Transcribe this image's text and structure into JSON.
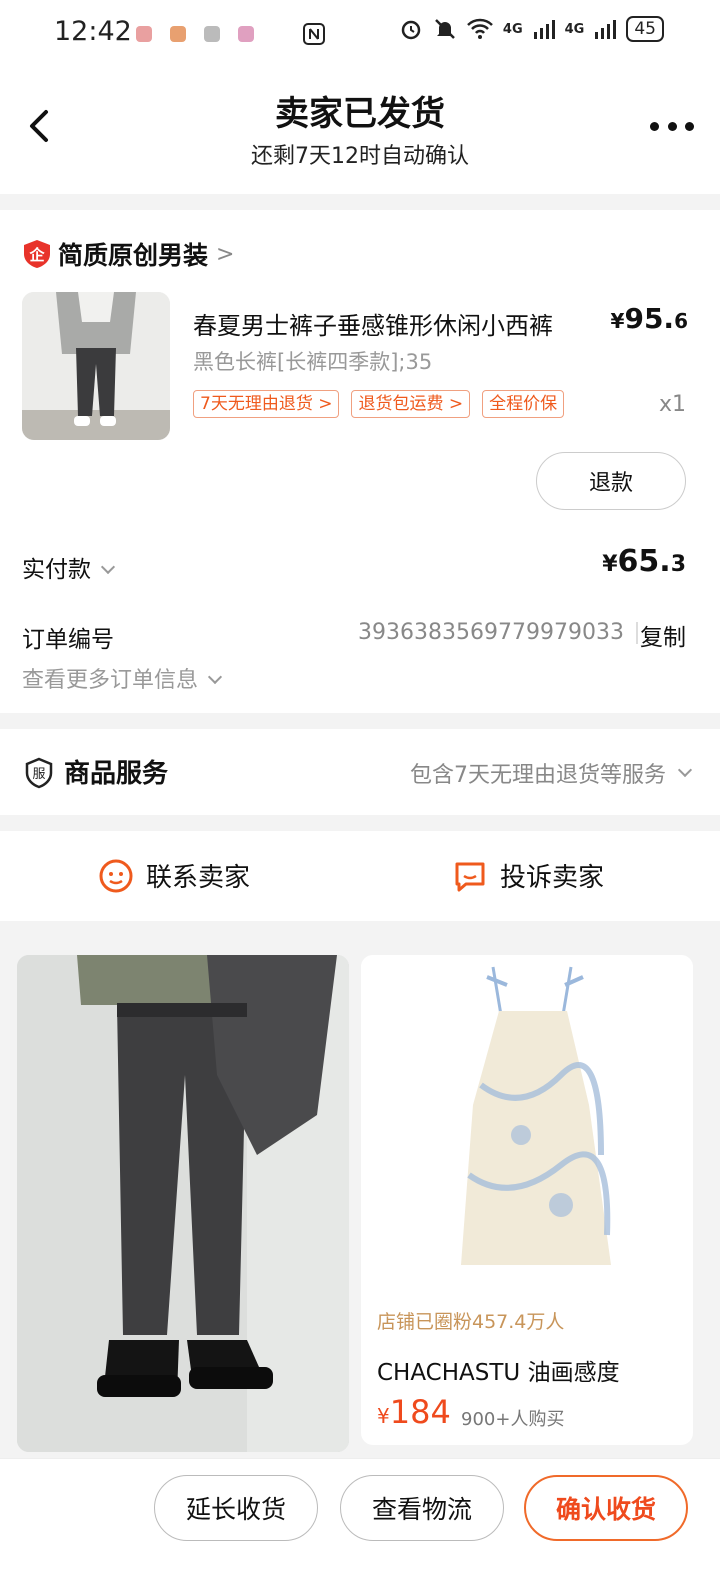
{
  "status_bar": {
    "time": "12:42",
    "network_1": "4G",
    "network_2": "4G",
    "battery": "45",
    "icons": [
      "alarm-icon",
      "mute-icon",
      "wifi-icon",
      "nfc-icon"
    ]
  },
  "header": {
    "title": "卖家已发货",
    "subtitle": "还剩7天12时自动确认"
  },
  "shop": {
    "badge_char": "企",
    "name": "简质原创男装",
    "arrow": ">"
  },
  "product": {
    "title": "春夏男士裤子垂感锥形休闲小西裤",
    "currency": "¥",
    "price_int": "95.",
    "price_dec": "6",
    "sku": "黑色长裤[长裤四季款];35",
    "tags": [
      "7天无理由退货 >",
      "退货包运费 >",
      "全程价保"
    ],
    "quantity": "x1",
    "refund_label": "退款"
  },
  "payment": {
    "label": "实付款",
    "currency": "¥",
    "amount_int": "65.",
    "amount_dec": "3"
  },
  "order": {
    "number_label": "订单编号",
    "number_value": "3936383569779979033",
    "copy_label": "复制",
    "more_info_label": "查看更多订单信息"
  },
  "services": {
    "icon_char": "服",
    "label": "商品服务",
    "description": "包含7天无理由退货等服务"
  },
  "contact": {
    "contact_seller": "联系卖家",
    "complain_seller": "投诉卖家"
  },
  "recommendations": {
    "right": {
      "shop_line": "店铺已圈粉457.4万人",
      "name": "CHACHASTU 油画感度",
      "currency": "¥",
      "price": "184",
      "sold": "900+人购买"
    }
  },
  "bottom_bar": {
    "extend": "延长收货",
    "logistics": "查看物流",
    "confirm": "确认收货"
  },
  "colors": {
    "accent": "#ef4a1d",
    "tag_border": "#f0a080",
    "shop_badge": "#e8332a"
  }
}
